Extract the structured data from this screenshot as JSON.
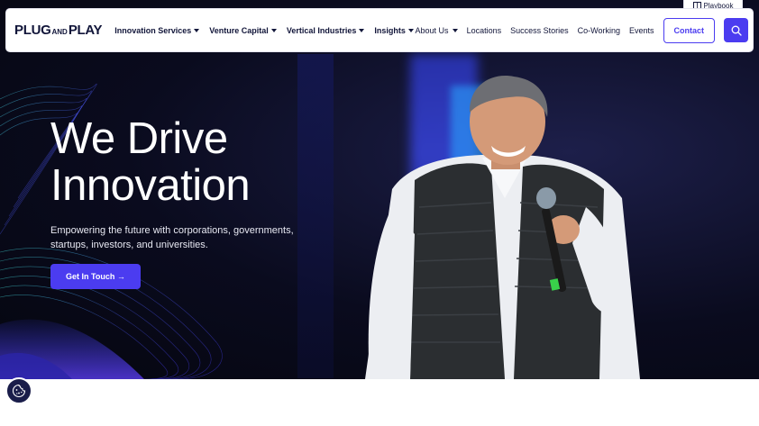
{
  "topbar": {
    "playbook_label": "Playbook",
    "playbook_icon": "book-icon"
  },
  "nav": {
    "logo": {
      "part1": "PLUG",
      "part2": "AND",
      "part3": "PLAY"
    },
    "left_items": [
      {
        "label": "Innovation Services"
      },
      {
        "label": "Venture Capital"
      },
      {
        "label": "Vertical Industries"
      },
      {
        "label": "Insights"
      }
    ],
    "right_items": {
      "about": "About Us",
      "locations": "Locations",
      "success": "Success Stories",
      "coworking": "Co-Working",
      "events": "Events"
    },
    "contact_label": "Contact",
    "search_icon": "search-icon"
  },
  "hero": {
    "title_line1": "We Drive",
    "title_line2": "Innovation",
    "subtitle": "Empowering the future with corporations, governments, startups, investors, and universities.",
    "cta_label": "Get In Touch →"
  },
  "cookie": {
    "icon": "cookie-icon"
  },
  "colors": {
    "accent": "#4b3cf0",
    "navy": "#12163a",
    "hero_bg": "#0a0b1e"
  }
}
